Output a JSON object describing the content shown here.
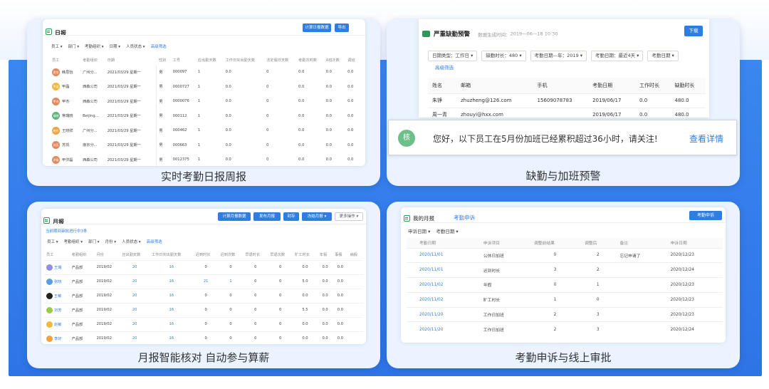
{
  "cards": {
    "daily": {
      "title": "日报",
      "caption": "实时考勤日报周报",
      "btn_calc": "计算日报数据",
      "btn_export": "导出",
      "filters": [
        "员工 ▾",
        "部门 ▾",
        "考勤组织 ▾",
        "日期 ▾",
        "人员状态 ▾"
      ],
      "adv_filter": "高级筛选",
      "columns": [
        "员工",
        "考勤组织",
        "日期",
        "",
        "性别",
        "工号",
        "应出勤天数",
        "工作日实出勤天数",
        "法定假日天数",
        "考勤次时数",
        "A班次数",
        "调班"
      ],
      "rows": [
        {
          "name": "韩思怡",
          "org": "广州分...",
          "date": "2021/03/29 星期一",
          "sex": "男",
          "no": "000097",
          "a": "1",
          "b": "0.0",
          "c": "0",
          "d": "0.0",
          "e": "0.0",
          "f": "0.0",
          "color": "#e4875c"
        },
        {
          "name": "甲晶",
          "org": "西森公司",
          "date": "2021/03/29 星期一",
          "sex": "男",
          "no": "0000727",
          "a": "1",
          "b": "0.0",
          "c": "0",
          "d": "0.0",
          "e": "0.0",
          "f": "0.0",
          "color": "#f0b83f"
        },
        {
          "name": "甲杰",
          "org": "西森公司",
          "date": "2021/03/29 星期一",
          "sex": "男",
          "no": "0000076",
          "a": "1",
          "b": "0.0",
          "c": "0",
          "d": "0.0",
          "e": "0.0",
          "f": "0.0",
          "color": "#e4875c"
        },
        {
          "name": "蒋瑞晓",
          "org": "Beijing...",
          "date": "2021/03/29 星期一",
          "sex": "男",
          "no": "000112",
          "a": "1",
          "b": "0.0",
          "c": "0",
          "d": "0.0",
          "e": "0.0",
          "f": "0.0",
          "color": "#5fb67a"
        },
        {
          "name": "王晓祥",
          "org": "广州分...",
          "date": "2021/03/29 星期一",
          "sex": "男",
          "no": "000462",
          "a": "1",
          "b": "0.0",
          "c": "0",
          "d": "0.0",
          "e": "0.0",
          "f": "0.0",
          "color": "#f0a23f"
        },
        {
          "name": "苏凯",
          "org": "南京分...",
          "date": "2021/03/29 星期一",
          "sex": "男",
          "no": "000663",
          "a": "1",
          "b": "0.0",
          "c": "0",
          "d": "0.0",
          "e": "0.0",
          "f": "0.0",
          "color": "#e4875c"
        },
        {
          "name": "甲洪磊",
          "org": "西森公司",
          "date": "2021/03/29 星期一",
          "sex": "男",
          "no": "0012375",
          "a": "1",
          "b": "0.0",
          "c": "0",
          "d": "0.0",
          "e": "0.0",
          "f": "0.0",
          "color": "#e4875c"
        }
      ]
    },
    "alert": {
      "title": "严重缺勤预警",
      "generated_label": "数据生成时间：",
      "generated_time": "2019—06—18 10:30",
      "btn_download": "下载",
      "selects": [
        "日期类型：工作日 ▾",
        "缺勤时长：480 ▾",
        "考勤日期—年：2019 ▾",
        "考勤日期：最近4天 ▾",
        "考勤日期 ▾"
      ],
      "adv_filter": "高级筛选",
      "columns": [
        "姓名",
        "邮箱",
        "手机",
        "考勤日期",
        "工作时长",
        "缺勤时长"
      ],
      "rows": [
        {
          "name": "朱铮",
          "email": "zhuzheng@126.com",
          "phone": "15609078783",
          "date": "2019/06/17",
          "work": "0.0",
          "absent": "480.0"
        },
        {
          "name": "周一青",
          "email": "zhouyi@hxx.com",
          "phone": "",
          "date": "2019/06/17",
          "work": "0.0",
          "absent": "480.0"
        }
      ],
      "notice_avatar": "核",
      "notice_text": "您好，以下员工在5月份加班已经累积超过36小时，请关注!",
      "notice_link": "查看详情",
      "caption": "缺勤与加班预警"
    },
    "monthly": {
      "title": "月报",
      "caption": "月报智能核对 自动参与算薪",
      "buttons": [
        "计算月报数据",
        "发布月报",
        "封存",
        "冻结月报 ▾"
      ],
      "more": "更多操作 ▾",
      "status": "当前期间审批进行中3条",
      "filters": [
        "员工 ▾",
        "考勤组织 ▾",
        "部门 ▾",
        "月份 ▾",
        "人员状态 ▾"
      ],
      "adv_filter": "高级筛选",
      "columns": [
        "员工",
        "考勤组织",
        "月份",
        "应出勤天数",
        "工作日实出勤天数",
        "迟到时长",
        "迟到次数",
        "早退时长",
        "早退次数",
        "旷工时长",
        "年假",
        "事假",
        "病假"
      ],
      "rows": [
        {
          "name": "王瑞",
          "org": "产品部",
          "month": "2019/02",
          "v": [
            "20",
            "16",
            "0",
            "0",
            "0",
            "0",
            "0.0",
            "0.0",
            "0.0"
          ],
          "color": "#8e8fe0"
        },
        {
          "name": "张晓",
          "org": "产品部",
          "month": "2019/02",
          "v": [
            "20",
            "16",
            "21",
            "1",
            "0",
            "0",
            "5.0",
            "0.0",
            "0.0"
          ],
          "color": "#5b9ee0"
        },
        {
          "name": "王敏",
          "org": "产品部",
          "month": "2019/02",
          "v": [
            "20",
            "16",
            "0",
            "0",
            "0",
            "0",
            "0.0",
            "0.0",
            "0.0"
          ],
          "color": "#222222"
        },
        {
          "name": "刘芳",
          "org": "产品部",
          "month": "2019/02",
          "v": [
            "20",
            "16",
            "0",
            "0",
            "0",
            "0",
            "5.5",
            "0.0",
            "0.0"
          ],
          "color": "#9cc94a"
        },
        {
          "name": "赵敏",
          "org": "产品部",
          "month": "2019/02",
          "v": [
            "20",
            "16",
            "0",
            "0",
            "0",
            "0",
            "0.0",
            "0.0",
            "0.0"
          ],
          "color": "#f0b83f"
        },
        {
          "name": "李好",
          "org": "产品部",
          "month": "2019/02",
          "v": [
            "20",
            "16",
            "0",
            "0",
            "0",
            "0",
            "0.0",
            "0.0",
            "0.0"
          ],
          "color": "#f0a23f"
        }
      ]
    },
    "appeal": {
      "tab_mine": "我的月报",
      "tab_appeal": "考勤申诉",
      "btn_appeal": "考勤申诉",
      "filters": [
        "申诉日期 ▾",
        "考勤日期 ▾"
      ],
      "columns": [
        "考勤日期",
        "申诉项目",
        "调整前结果",
        "调整后",
        "备注",
        "申诉日期"
      ],
      "rows": [
        {
          "date": "2020/11/01",
          "item": "公休日加班",
          "before": "0",
          "after": "2",
          "note": "忘记申请了",
          "adate": "2020/12/23"
        },
        {
          "date": "2020/11/01",
          "item": "迟到时长",
          "before": "3",
          "after": "2",
          "note": "",
          "adate": "2020/12/24"
        },
        {
          "date": "2020/11/02",
          "item": "年假",
          "before": "0",
          "after": "1",
          "note": "",
          "adate": "2020/12/23"
        },
        {
          "date": "2020/11/02",
          "item": "旷工时长",
          "before": "1",
          "after": "0",
          "note": "",
          "adate": "2020/12/23"
        },
        {
          "date": "2020/11/20",
          "item": "工作日加班",
          "before": "2",
          "after": "3",
          "note": "",
          "adate": "2020/12/23"
        },
        {
          "date": "2020/11/20",
          "item": "工作日加班",
          "before": "2",
          "after": "3",
          "note": "",
          "adate": "2020/12/24"
        }
      ],
      "caption": "考勤申诉与线上审批"
    }
  },
  "colors": {
    "accent": "#2f7de1",
    "bg_blue": "#2f74e6",
    "card": "#eaf3ff"
  }
}
